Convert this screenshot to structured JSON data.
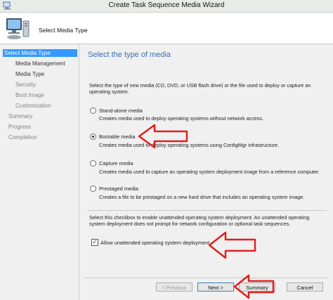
{
  "window": {
    "title": "Create Task Sequence Media Wizard"
  },
  "header": {
    "title": "Select Media Type"
  },
  "sidebar": {
    "items": [
      {
        "label": "Select Media Type",
        "state": "active"
      },
      {
        "label": "Media Management",
        "state": "normal"
      },
      {
        "label": "Media Type",
        "state": "normal"
      },
      {
        "label": "Security",
        "state": "disabled"
      },
      {
        "label": "Boot Image",
        "state": "disabled"
      },
      {
        "label": "Customization",
        "state": "disabled"
      },
      {
        "label": "Summary",
        "state": "disabled"
      },
      {
        "label": "Progress",
        "state": "disabled"
      },
      {
        "label": "Completion",
        "state": "disabled"
      }
    ]
  },
  "main": {
    "section_title": "Select the type of media",
    "intro": "Select the type of new media (CD, DVD, or USB flash drive) or the file used to deploy or capture an operating system.",
    "options": [
      {
        "label": "Stand-alone media",
        "description": "Creates media used to deploy operating systems without network access.",
        "selected": false
      },
      {
        "label": "Bootable media",
        "description": "Creates media used to deploy operating systems using ConfigMgr infrastructure.",
        "selected": true
      },
      {
        "label": "Capture media",
        "description": "Creates media used to capture an operating system deployment image from a reference computer.",
        "selected": false
      },
      {
        "label": "Prestaged media",
        "description": "Creates a file to be prestaged on a new hard drive that includes an operating system image.",
        "selected": false
      }
    ],
    "unattended_note": "Select this checkbox to enable unattended operating system deployment. An unattended operating system deployment does not prompt for network configuration or optional task sequences.",
    "unattended_checkbox": {
      "label": "Allow unattended operating system deployment.",
      "checked": true
    }
  },
  "footer": {
    "previous_label": "< Previous",
    "next_label": "Next >",
    "summary_label": "Summary",
    "cancel_label": "Cancel"
  },
  "colors": {
    "accent_selected": "#3399ff",
    "section_title": "#3a6db5",
    "annotation_arrow": "#e02020"
  }
}
